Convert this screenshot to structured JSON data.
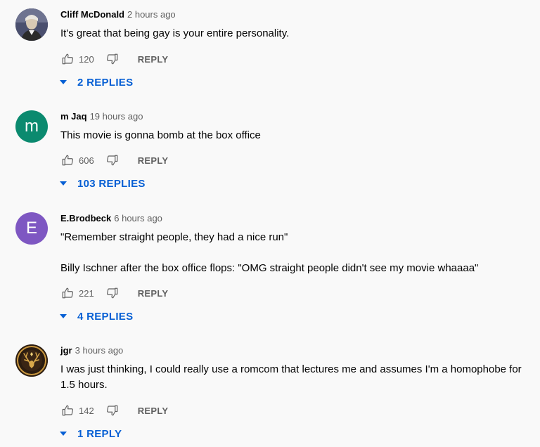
{
  "reply_label": "REPLY",
  "colors": {
    "link_blue": "#065fd4",
    "secondary_text": "#606060",
    "avatar_m": "#0b8a6f",
    "avatar_e": "#7e57c2"
  },
  "comments": [
    {
      "author": "Cliff McDonald",
      "time": "2 hours ago",
      "avatar": "photo-portrait",
      "text": [
        "It's great that being gay is your entire personality."
      ],
      "likes": "120",
      "replies": "2 REPLIES"
    },
    {
      "author": "m Jaq",
      "time": "19 hours ago",
      "avatar": "m",
      "text": [
        "This movie is gonna bomb at the box office"
      ],
      "likes": "606",
      "replies": "103 REPLIES"
    },
    {
      "author": "E.Brodbeck",
      "time": "6 hours ago",
      "avatar": "E",
      "text": [
        "\"Remember straight people, they had a nice run\"",
        "Billy Ischner after the box office flops: \"OMG straight people didn't see my movie whaaaa\""
      ],
      "likes": "221",
      "replies": "4 REPLIES"
    },
    {
      "author": "jgr",
      "time": "3 hours ago",
      "avatar": "stag-emblem",
      "text": [
        "I was just thinking, I could really use a romcom that lectures me and assumes I'm a homophobe for 1.5 hours."
      ],
      "likes": "142",
      "replies": "1 REPLY"
    }
  ]
}
